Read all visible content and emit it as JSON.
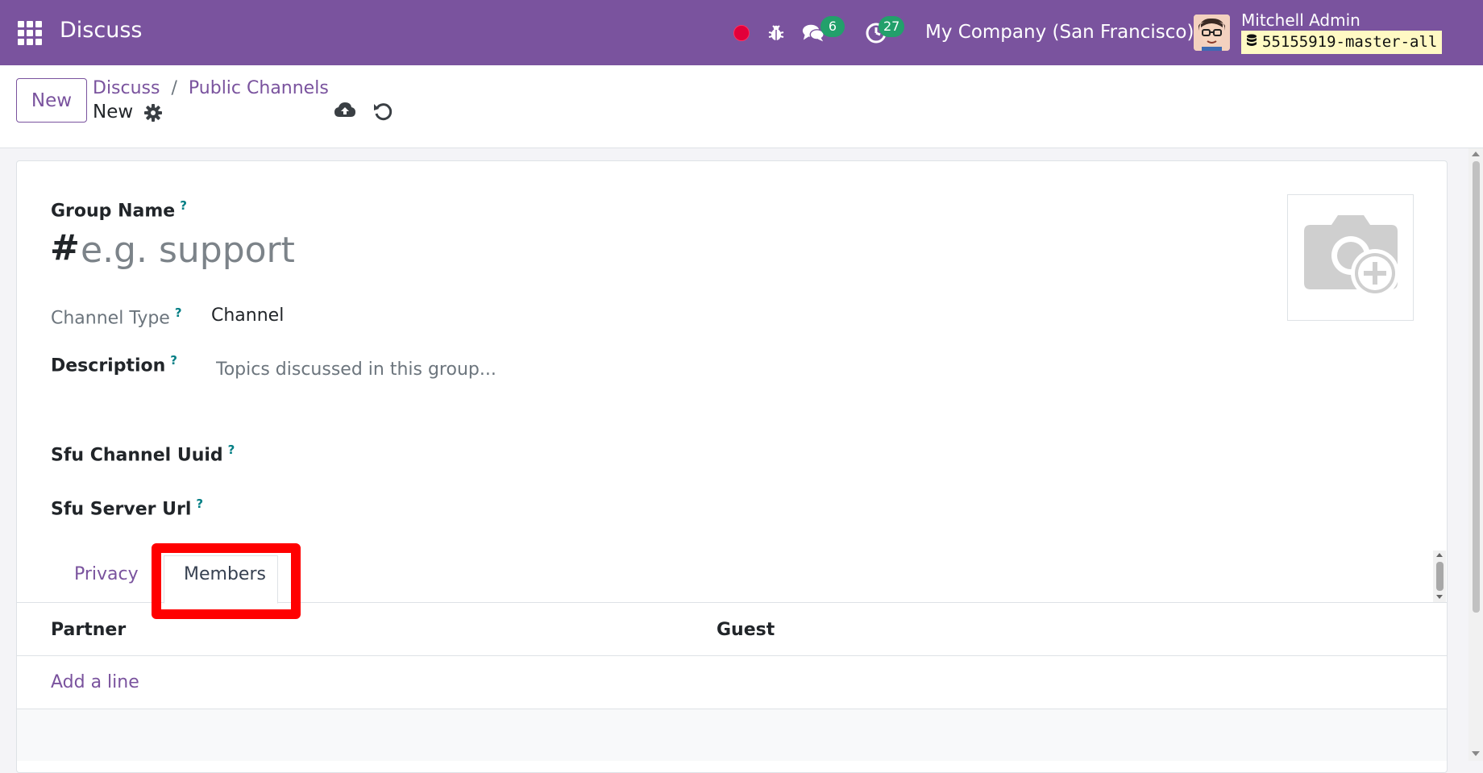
{
  "navbar": {
    "app_title": "Discuss",
    "chat_count": "6",
    "activity_count": "27",
    "company": "My Company (San Francisco)",
    "user_name": "Mitchell Admin",
    "database": "55155919-master-all",
    "icons": [
      "apps-grid-icon",
      "record-icon",
      "bug-icon",
      "chat-icon",
      "activity-clock-icon",
      "database-icon"
    ],
    "colors": {
      "brand": "#7a539e",
      "badge": "#22a06b",
      "record": "#e3003a"
    }
  },
  "control": {
    "new_label": "New",
    "breadcrumb": [
      "Discuss",
      "Public Channels"
    ],
    "breadcrumb_separator": "/",
    "record_name": "New"
  },
  "form": {
    "group_name_label": "Group Name",
    "help_mark": "?",
    "hash": "#",
    "group_name_placeholder": "e.g. support",
    "group_name_value": "",
    "channel_type_label": "Channel Type",
    "channel_type_value": "Channel",
    "description_label": "Description",
    "description_placeholder": "Topics discussed in this group...",
    "sfu_uuid_label": "Sfu Channel Uuid",
    "sfu_url_label": "Sfu Server Url"
  },
  "tabs": [
    {
      "label": "Privacy",
      "active": false
    },
    {
      "label": "Members",
      "active": true
    }
  ],
  "members_table": {
    "columns": [
      "Partner",
      "Guest"
    ],
    "add_line_label": "Add a line"
  },
  "annotation": {
    "highlight_color": "#ff0000",
    "highlighted": "Members"
  }
}
